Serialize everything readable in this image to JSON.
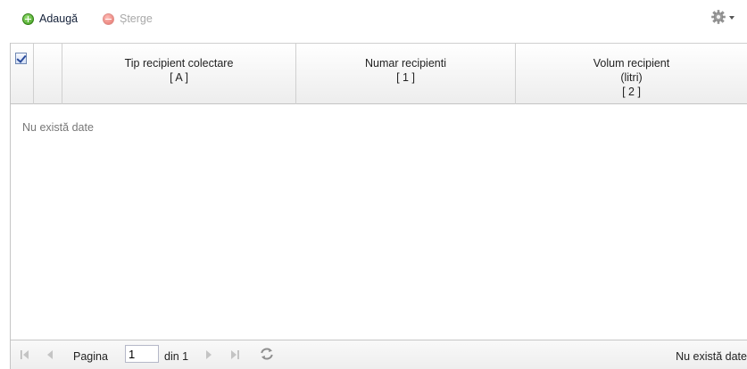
{
  "toolbar": {
    "add_label": "Adaugă",
    "delete_label": "Șterge",
    "settings_icon": "gear-icon"
  },
  "grid": {
    "columns": [
      {
        "title": "Tip recipient colectare",
        "code": "[ A ]"
      },
      {
        "title": "Numar recipienti",
        "code": "[ 1 ]"
      },
      {
        "title": "Volum recipient",
        "subtitle": "(litri)",
        "code": "[ 2 ]"
      }
    ],
    "select_all_checked": true,
    "empty_message": "Nu există date"
  },
  "pager": {
    "page_label": "Pagina",
    "page_value": "1",
    "of_label": "din 1",
    "status": "Nu există date"
  },
  "colors": {
    "accent_add": "#3c9a1a",
    "accent_delete": "#e05a50",
    "header_border": "#c5c5c5"
  }
}
